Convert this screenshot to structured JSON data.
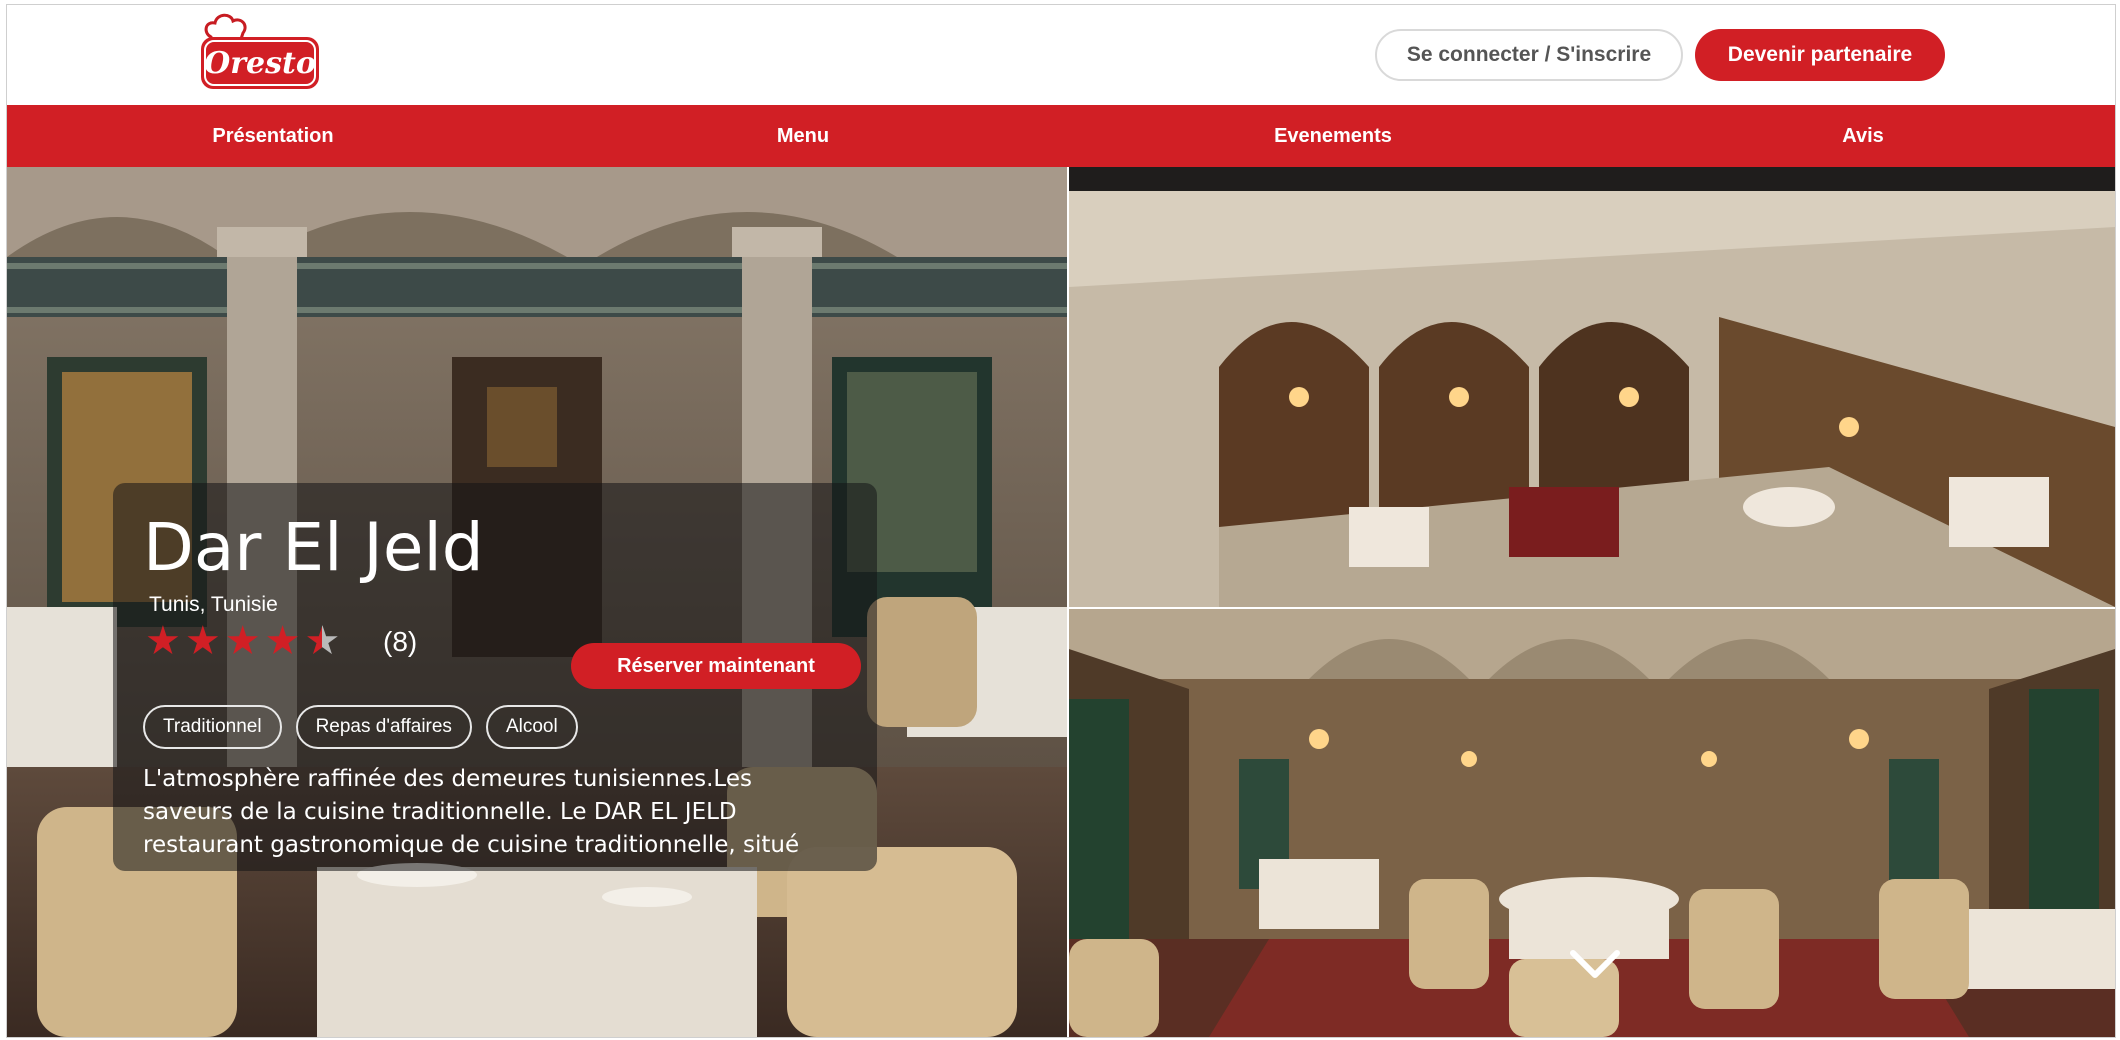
{
  "brand": {
    "logo_text": "Oresto",
    "accent": "#d11f25"
  },
  "header": {
    "login_label": "Se connecter / S'inscrire",
    "partner_label": "Devenir partenaire"
  },
  "nav": {
    "items": [
      {
        "label": "Présentation"
      },
      {
        "label": "Menu"
      },
      {
        "label": "Evenements"
      },
      {
        "label": "Avis"
      }
    ]
  },
  "restaurant": {
    "name": "Dar El Jeld",
    "location": "Tunis, Tunisie",
    "rating": 4.5,
    "rating_max": 5,
    "review_count": "(8)",
    "reserve_label": "Réserver maintenant",
    "tags": [
      "Traditionnel",
      "Repas d'affaires",
      "Alcool"
    ],
    "description": "L'atmosphère raffinée des demeures tunisiennes.Les saveurs de la cuisine traditionnelle. Le DAR EL JELD restaurant gastronomique de cuisine traditionnelle, situé"
  },
  "icons": {
    "scroll": "chevron-down-icon",
    "star": "star-icon"
  }
}
